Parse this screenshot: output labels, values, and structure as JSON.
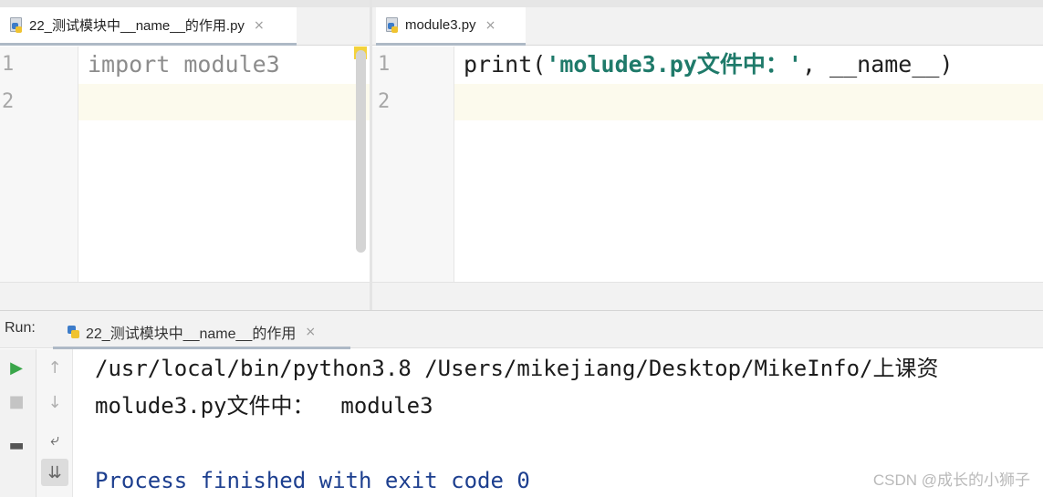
{
  "left_editor": {
    "tab": {
      "label": "22_测试模块中__name__的作用.py",
      "close": "×",
      "icon": "python-file-icon"
    },
    "line_numbers": [
      "1",
      "2"
    ],
    "code_lines": [
      "import module3",
      ""
    ]
  },
  "right_editor": {
    "tab": {
      "label": "module3.py",
      "close": "×",
      "icon": "python-file-icon"
    },
    "line_numbers": [
      "1",
      "2"
    ],
    "code": {
      "func": "print(",
      "string": "'molude3.py文件中：'",
      "rest": ", __name__)"
    }
  },
  "run_panel": {
    "label": "Run:",
    "tab": {
      "label": "22_测试模块中__name__的作用",
      "close": "×",
      "icon": "python-icon"
    },
    "toolbar": {
      "rerun": "▶",
      "stop": "■",
      "layout": "▬",
      "up": "↑",
      "down": "↓",
      "soft_wrap": "⤶",
      "scroll_to_end": "⇊"
    },
    "output": [
      "/usr/local/bin/python3.8 /Users/mikejiang/Desktop/MikeInfo/上课资",
      "molude3.py文件中：  module3",
      "",
      "Process finished with exit code 0"
    ]
  },
  "watermark": "CSDN @成长的小狮子",
  "colors": {
    "string": "#1f7a6a",
    "current_line": "#fcfaed",
    "run_green": "#3aa64a",
    "exit_text": "#1d3f8f"
  }
}
